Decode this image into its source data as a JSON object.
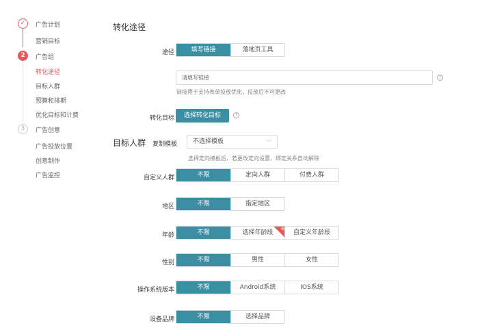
{
  "sidebar": {
    "steps": [
      {
        "num": "✓",
        "label": "广告计划"
      },
      {
        "num": "2",
        "label": "广告组"
      },
      {
        "num": "3",
        "label": "广告创意"
      }
    ],
    "plan_items": [
      "营销目标"
    ],
    "group_items": [
      "转化途径",
      "目标人群",
      "预算和排期",
      "优化目标和计费"
    ],
    "creative_items": [
      "广告投放位置",
      "创意制作",
      "广告监控"
    ]
  },
  "conversion": {
    "title": "转化途径",
    "path_label": "途径",
    "path_options": [
      "填写链接",
      "落地页工具"
    ],
    "link_placeholder": "请填写链接",
    "link_hint": "链接用于支持表单投放优化，投放后不可更改",
    "target_label": "转化目标",
    "target_button": "选择转化目标"
  },
  "audience": {
    "title": "目标人群",
    "copy_label": "复制模板",
    "template_select": "不选择模板",
    "template_hint": "选择定向模板后，若更改定向设置，绑定关系自动解除",
    "rows": {
      "custom": {
        "label": "自定义人群",
        "options": [
          "不限",
          "定向人群",
          "付费人群"
        ]
      },
      "region": {
        "label": "地区",
        "options": [
          "不限",
          "指定地区"
        ]
      },
      "age": {
        "label": "年龄",
        "options": [
          "不限",
          "选择年龄段",
          "自定义年龄段"
        ],
        "badge": "新"
      },
      "gender": {
        "label": "性别",
        "options": [
          "不限",
          "男性",
          "女性"
        ]
      },
      "os": {
        "label": "操作系统版本",
        "options": [
          "不限",
          "Android系统",
          "IOS系统"
        ]
      },
      "brand": {
        "label": "设备品牌",
        "options": [
          "不限",
          "选择品牌"
        ]
      }
    }
  },
  "colors": {
    "accent": "#3a8fa3",
    "brand_red": "#e8585b"
  }
}
